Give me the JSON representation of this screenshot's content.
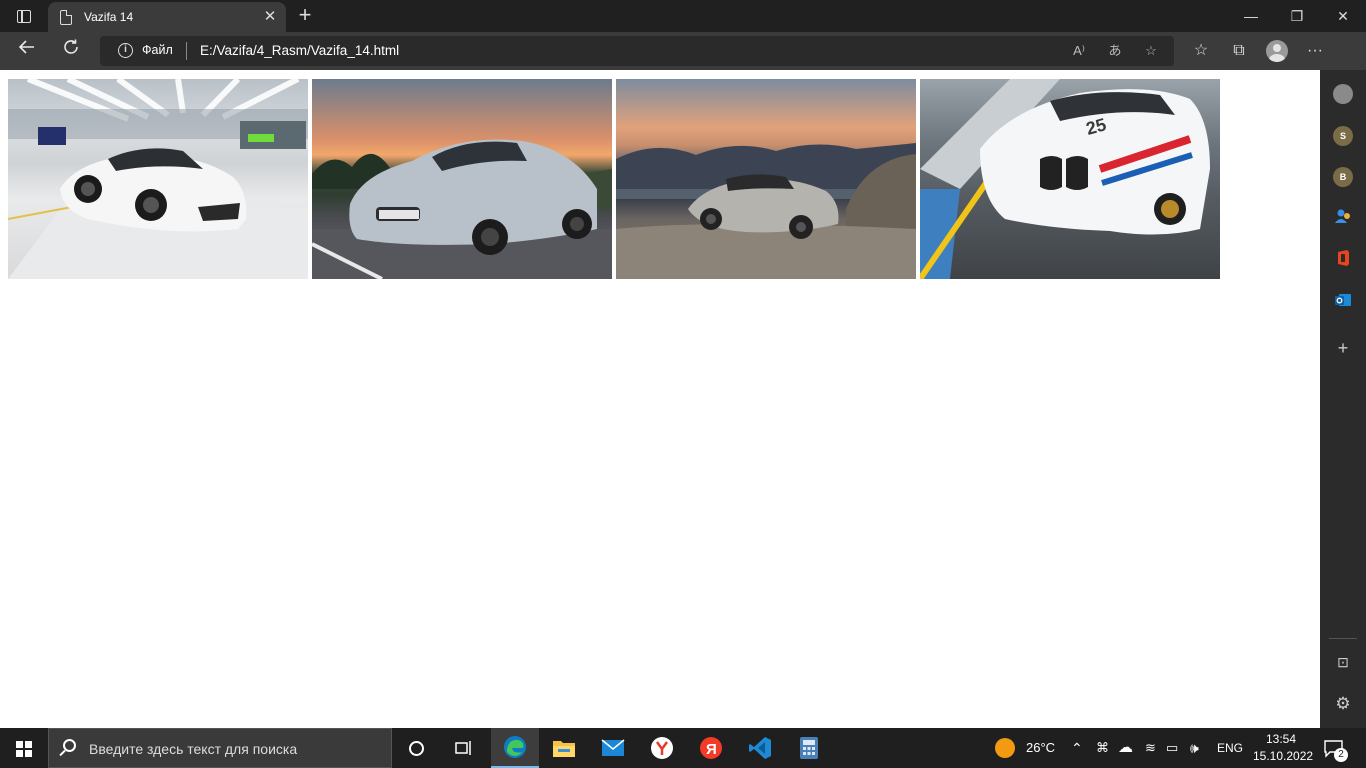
{
  "browser": {
    "tab_title": "Vazifa 14",
    "tab_close": "✕",
    "new_tab": "+",
    "scheme_label": "Файл",
    "url": "E:/Vazifa/4_Rasm/Vazifa_14.html",
    "window_controls": {
      "minimize": "—",
      "restore": "❐",
      "close": "✕"
    }
  },
  "page": {
    "images": [
      {
        "subject": "white sports car in showroom"
      },
      {
        "subject": "silver BMW M4 convertible at sunset"
      },
      {
        "subject": "silver Mercedes convertible on coastline"
      },
      {
        "subject": "white BMW race car on track"
      }
    ]
  },
  "sidebar": {
    "items": [
      {
        "icon": "gray-circle-icon",
        "label": ""
      },
      {
        "icon": "s-circle-icon",
        "label": "S"
      },
      {
        "icon": "b-circle-icon",
        "label": "B"
      },
      {
        "icon": "people-icon",
        "label": ""
      },
      {
        "icon": "office-icon",
        "label": ""
      },
      {
        "icon": "outlook-icon",
        "label": ""
      }
    ]
  },
  "taskbar": {
    "search_placeholder": "Введите здесь текст для поиска",
    "weather_temp": "26°C",
    "language": "ENG",
    "time": "13:54",
    "date": "15.10.2022",
    "notification_count": "2"
  },
  "colors": {
    "titlebar": "#202020",
    "toolbar": "#3b3b3b",
    "taskbar": "#1f1f1f",
    "accent": "#76b9ed"
  }
}
